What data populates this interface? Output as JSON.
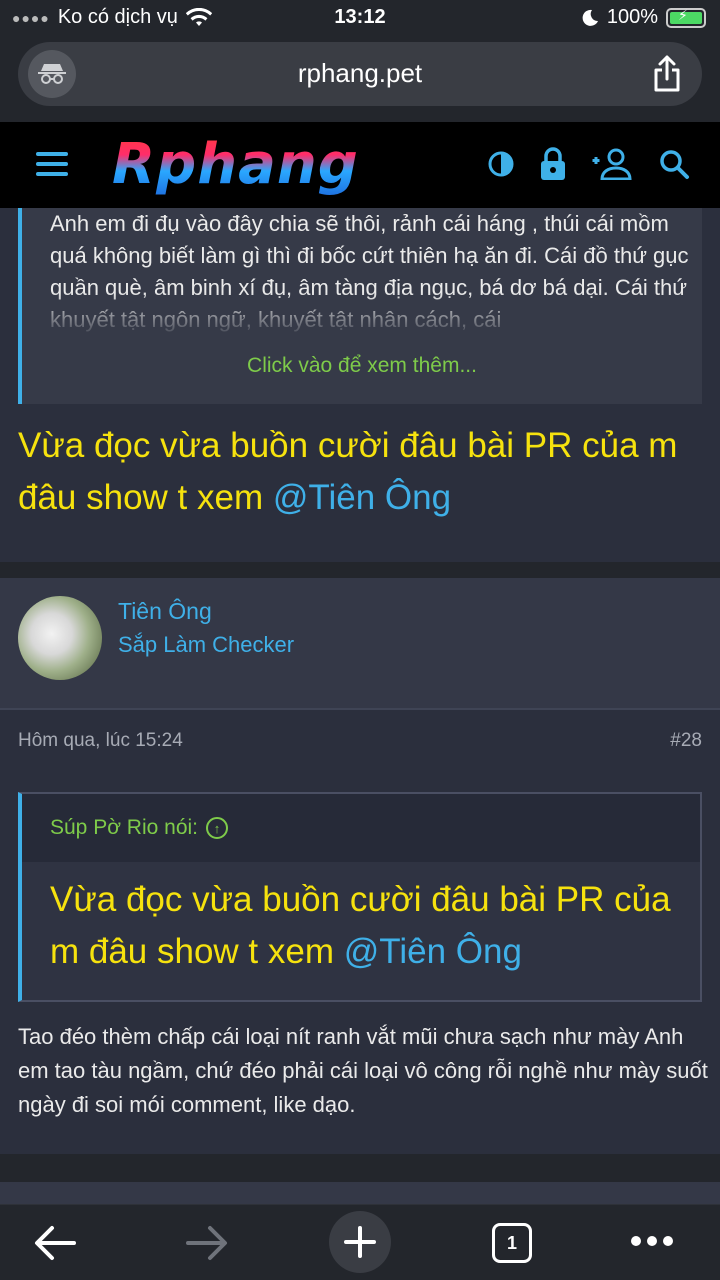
{
  "status": {
    "carrier": "Ko có dịch vụ",
    "time": "13:12",
    "battery": "100%"
  },
  "browser": {
    "url": "rphang.pet"
  },
  "site": {
    "logo": "Rphang"
  },
  "quote_top": {
    "text": "Anh em đi đụ vào đây chia sẽ thôi, rảnh cái háng , thúi cái mồm quá không biết làm gì thì đi bốc cứt thiên hạ ăn đi. Cái đồ thứ gục quần què, âm binh xí đụ, âm tàng địa ngục, bá dơ bá dại. Cái thứ khuyết tật ngôn ngữ, khuyết tật nhân cách, cái",
    "more": "Click vào để xem thêm..."
  },
  "post1": {
    "text": "Vừa đọc vừa buồn cười đâu bài PR của m đâu show t xem ",
    "mention": "@Tiên Ông"
  },
  "user": {
    "name": "Tiên Ông",
    "title": "Sắp Làm Checker"
  },
  "post2": {
    "time": "Hôm qua, lúc 15:24",
    "number": "#28",
    "quote_author": "Súp Pờ Rio nói:",
    "quote_text": "Vừa đọc vừa buồn cười đâu bài PR của m đâu show t xem ",
    "quote_mention": "@Tiên Ông",
    "body": "Tao đéo thèm chấp cái loại nít ranh vắt mũi chưa sạch như mày Anh em tao tàu ngầm, chứ đéo phải cái loại vô công rỗi nghề như mày suốt ngày đi soi mói comment, like dạo."
  },
  "toolbar": {
    "tab_count": "1"
  },
  "colors": {
    "accent": "#3fb0e8",
    "highlight": "#f6e20e",
    "green": "#7ecb4a",
    "bg": "#2b2f3d"
  }
}
